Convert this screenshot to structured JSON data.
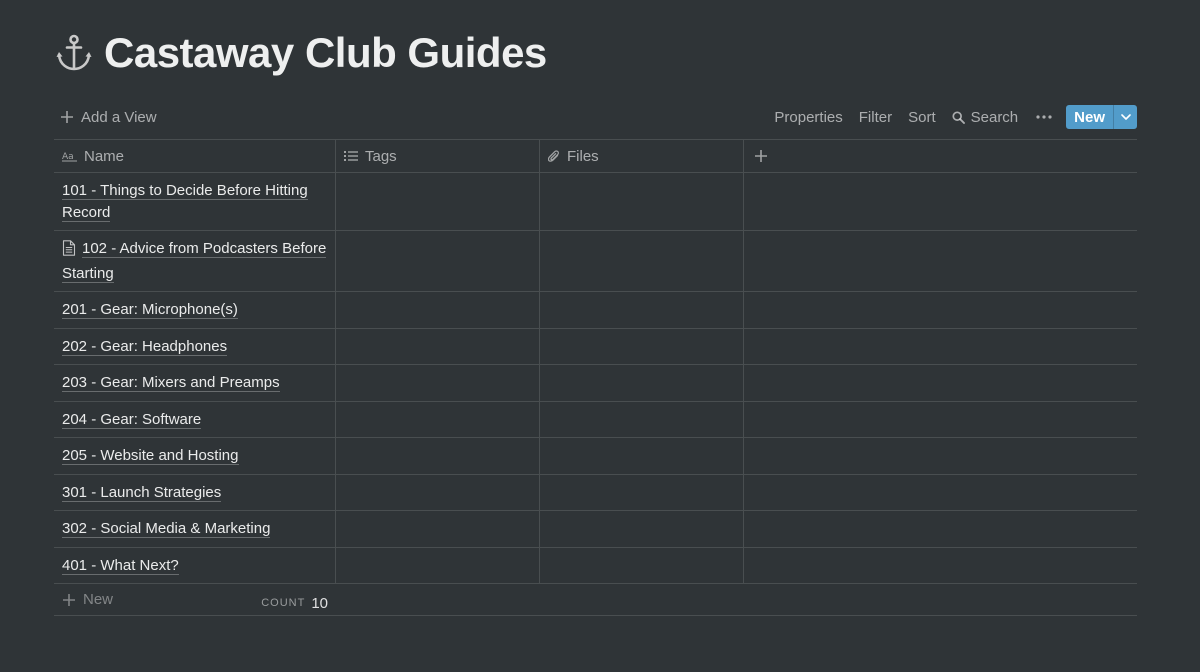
{
  "title": {
    "emoji": "⚓",
    "text": "Castaway Club Guides"
  },
  "toolbar": {
    "add_view": "Add a View",
    "properties": "Properties",
    "filter": "Filter",
    "sort": "Sort",
    "search": "Search",
    "new": "New"
  },
  "table": {
    "columns": [
      {
        "label": "Name",
        "icon": "text-type-icon"
      },
      {
        "label": "Tags",
        "icon": "list-icon"
      },
      {
        "label": "Files",
        "icon": "paperclip-icon"
      }
    ],
    "rows": [
      {
        "name": "101 - Things to Decide Before Hitting Record"
      },
      {
        "name": "102 - Advice from Podcasters Before Starting",
        "icon": "document-icon"
      },
      {
        "name": "201 - Gear: Microphone(s)"
      },
      {
        "name": "202 - Gear: Headphones"
      },
      {
        "name": "203 - Gear: Mixers and Preamps"
      },
      {
        "name": "204 - Gear: Software"
      },
      {
        "name": "205 - Website and Hosting"
      },
      {
        "name": "301 - Launch Strategies"
      },
      {
        "name": "302 - Social Media & Marketing"
      },
      {
        "name": "401 - What Next?"
      }
    ],
    "new_row_label": "New",
    "count_label": "COUNT",
    "count_value": "10"
  },
  "colors": {
    "background": "#2f3437",
    "accent": "#529cca"
  }
}
